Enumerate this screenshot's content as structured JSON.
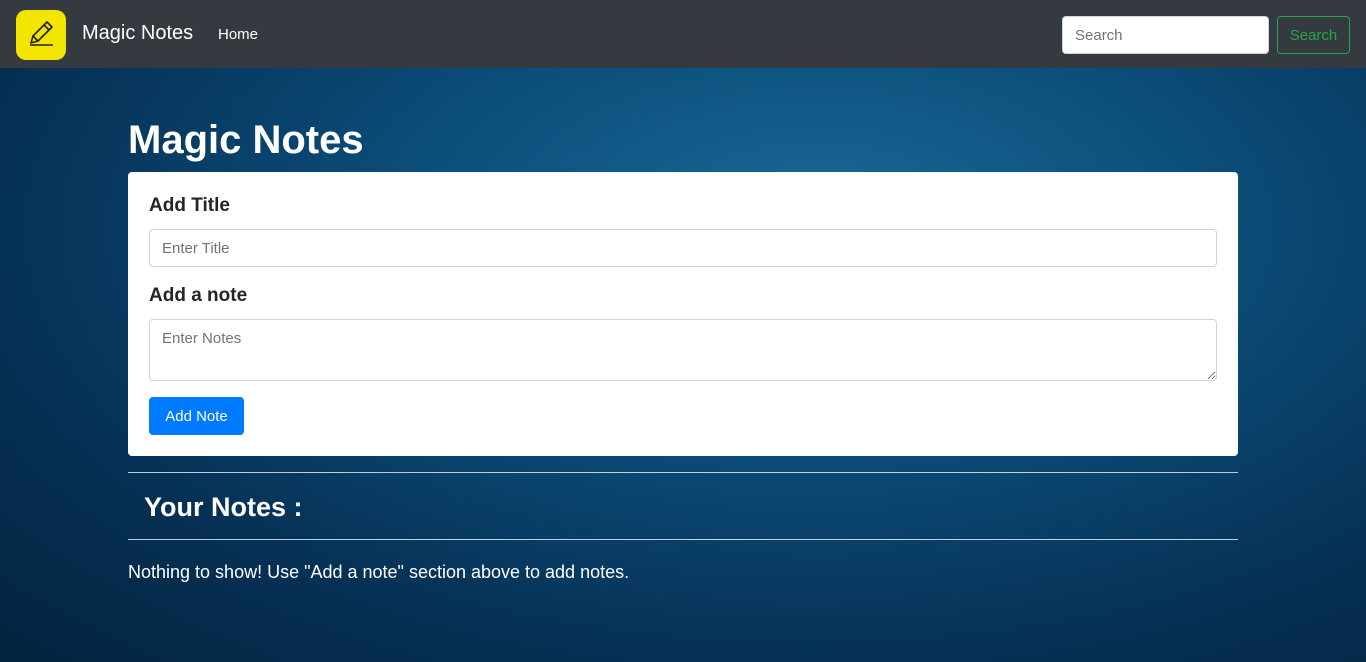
{
  "navbar": {
    "brand_name": "Magic Notes",
    "logo_icon": "pencil-icon",
    "logo_color": "#f2e600",
    "home_link": "Home",
    "search_placeholder": "Search",
    "search_button": "Search"
  },
  "main": {
    "page_title": "Magic Notes",
    "form": {
      "title_label": "Add Title",
      "title_placeholder": "Enter Title",
      "note_label": "Add a note",
      "note_placeholder": "Enter Notes",
      "add_button": "Add Note"
    },
    "notes_heading": "Your Notes :",
    "empty_message": "Nothing to show! Use \"Add a note\" section above to add notes."
  },
  "colors": {
    "navbar_bg": "#343a40",
    "primary": "#007bff",
    "success": "#28a745"
  }
}
